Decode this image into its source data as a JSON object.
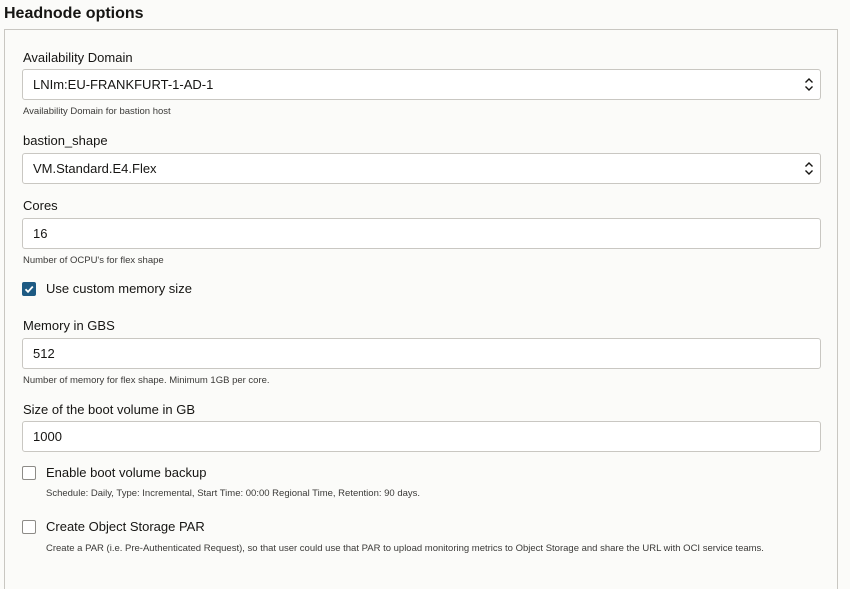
{
  "section": {
    "title": "Headnode options"
  },
  "availability_domain": {
    "label": "Availability Domain",
    "value": "LNIm:EU-FRANKFURT-1-AD-1",
    "help": "Availability Domain for bastion host"
  },
  "bastion_shape": {
    "label": "bastion_shape",
    "value": "VM.Standard.E4.Flex"
  },
  "cores": {
    "label": "Cores",
    "value": "16",
    "help": "Number of OCPU's for flex shape"
  },
  "custom_memory": {
    "label": "Use custom memory size",
    "checked": true
  },
  "memory": {
    "label": "Memory in GBS",
    "value": "512",
    "help": "Number of memory for flex shape. Minimum 1GB per core."
  },
  "boot_volume": {
    "label": "Size of the boot volume in GB",
    "value": "1000"
  },
  "boot_backup": {
    "label": "Enable boot volume backup",
    "checked": false,
    "help": "Schedule: Daily, Type: Incremental, Start Time: 00:00 Regional Time, Retention: 90 days."
  },
  "object_storage_par": {
    "label": "Create Object Storage PAR",
    "checked": false,
    "help": "Create a PAR (i.e. Pre-Authenticated Request), so that user could use that PAR to upload monitoring metrics to Object Storage and share the URL with OCI service teams."
  },
  "colors": {
    "accent": "#1d5a83",
    "border": "#c9c7c2",
    "background": "#fbfbf9"
  },
  "icons": {
    "select": "chevron-up-down-icon",
    "check": "checkmark-icon"
  }
}
